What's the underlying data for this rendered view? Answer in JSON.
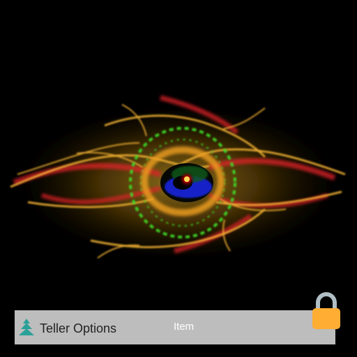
{
  "brand": {
    "name": "Teller Options",
    "logo_icon": "stacked-layers-icon",
    "logo_color": "#2aa198"
  },
  "bar": {
    "item_label": "Item",
    "background": "#bdbdbd"
  },
  "lock": {
    "icon": "padlock-icon",
    "body_color": "#ffad33",
    "shackle_color": "#b0bec5"
  },
  "artwork": {
    "subject": "fractal-flame",
    "background": "#000000"
  }
}
